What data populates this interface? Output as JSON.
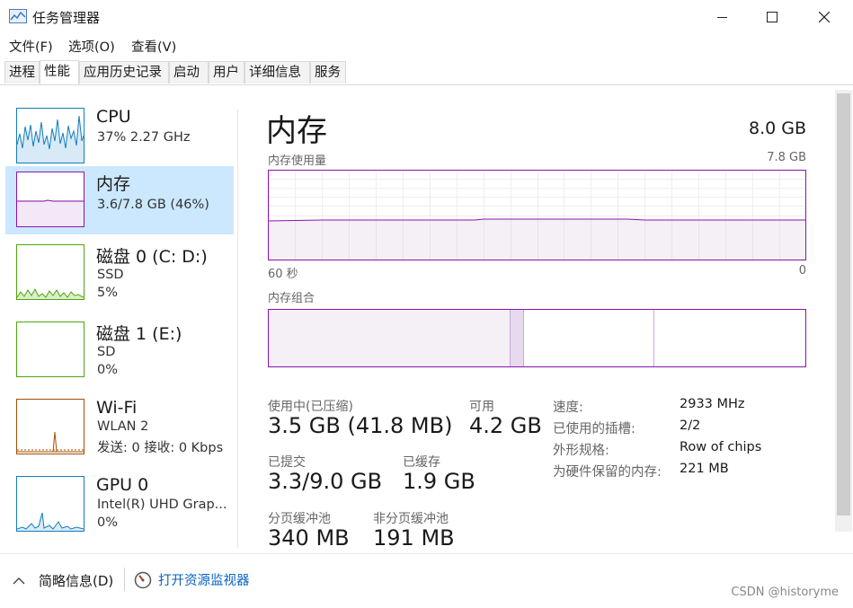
{
  "window": {
    "title": "任务管理器",
    "minimize_icon": "minimize-icon",
    "maximize_icon": "maximize-icon",
    "close_icon": "close-icon"
  },
  "menu": [
    "文件(F)",
    "选项(O)",
    "查看(V)"
  ],
  "tabs": [
    "进程",
    "性能",
    "应用历史记录",
    "启动",
    "用户",
    "详细信息",
    "服务"
  ],
  "active_tab": "性能",
  "sidebar": [
    {
      "name": "CPU",
      "line1": "37% 2.27 GHz",
      "line2": "",
      "color": "#117dbb"
    },
    {
      "name": "内存",
      "line1": "3.6/7.8 GB (46%)",
      "line2": "",
      "color": "#8b12ae"
    },
    {
      "name": "磁盘 0 (C: D:)",
      "line1": "SSD",
      "line2": "5%",
      "color": "#4da60c"
    },
    {
      "name": "磁盘 1 (E:)",
      "line1": "SD",
      "line2": "0%",
      "color": "#4da60c"
    },
    {
      "name": "Wi-Fi",
      "line1": "WLAN 2",
      "line2": "发送: 0 接收: 0 Kbps",
      "color": "#a74f01"
    },
    {
      "name": "GPU 0",
      "line1": "Intel(R) UHD Grap...",
      "line2": "0%",
      "color": "#117dbb"
    }
  ],
  "selected_index": 1,
  "memory": {
    "heading": "内存",
    "total": "8.0 GB",
    "usage_label": "内存使用量",
    "usage_max": "7.8 GB",
    "x_left": "60 秒",
    "x_right": "0",
    "usage_fraction": 0.46,
    "composition_label": "内存组合",
    "composition": {
      "in_use": 3.5,
      "modified": 0.2,
      "standby": 1.9,
      "free": 2.2
    },
    "stats": {
      "in_use_label": "使用中(已压缩)",
      "in_use_value": "3.5 GB (41.8 MB)",
      "available_label": "可用",
      "available_value": "4.2 GB",
      "committed_label": "已提交",
      "committed_value": "3.3/9.0 GB",
      "cached_label": "已缓存",
      "cached_value": "1.9 GB",
      "paged_label": "分页缓冲池",
      "paged_value": "340 MB",
      "nonpaged_label": "非分页缓冲池",
      "nonpaged_value": "191 MB"
    },
    "details": [
      {
        "key": "速度:",
        "value": "2933 MHz"
      },
      {
        "key": "已使用的插槽:",
        "value": "2/2"
      },
      {
        "key": "外形规格:",
        "value": "Row of chips"
      },
      {
        "key": "为硬件保留的内存:",
        "value": "221 MB"
      }
    ]
  },
  "bottom": {
    "summary": "简略信息(D)",
    "monitor_link": "打开资源监视器",
    "watermark": "CSDN @historyme"
  },
  "colors": {
    "memory": "#8b12ae",
    "selected_bg": "#cce8ff",
    "link": "#0b63c5"
  }
}
